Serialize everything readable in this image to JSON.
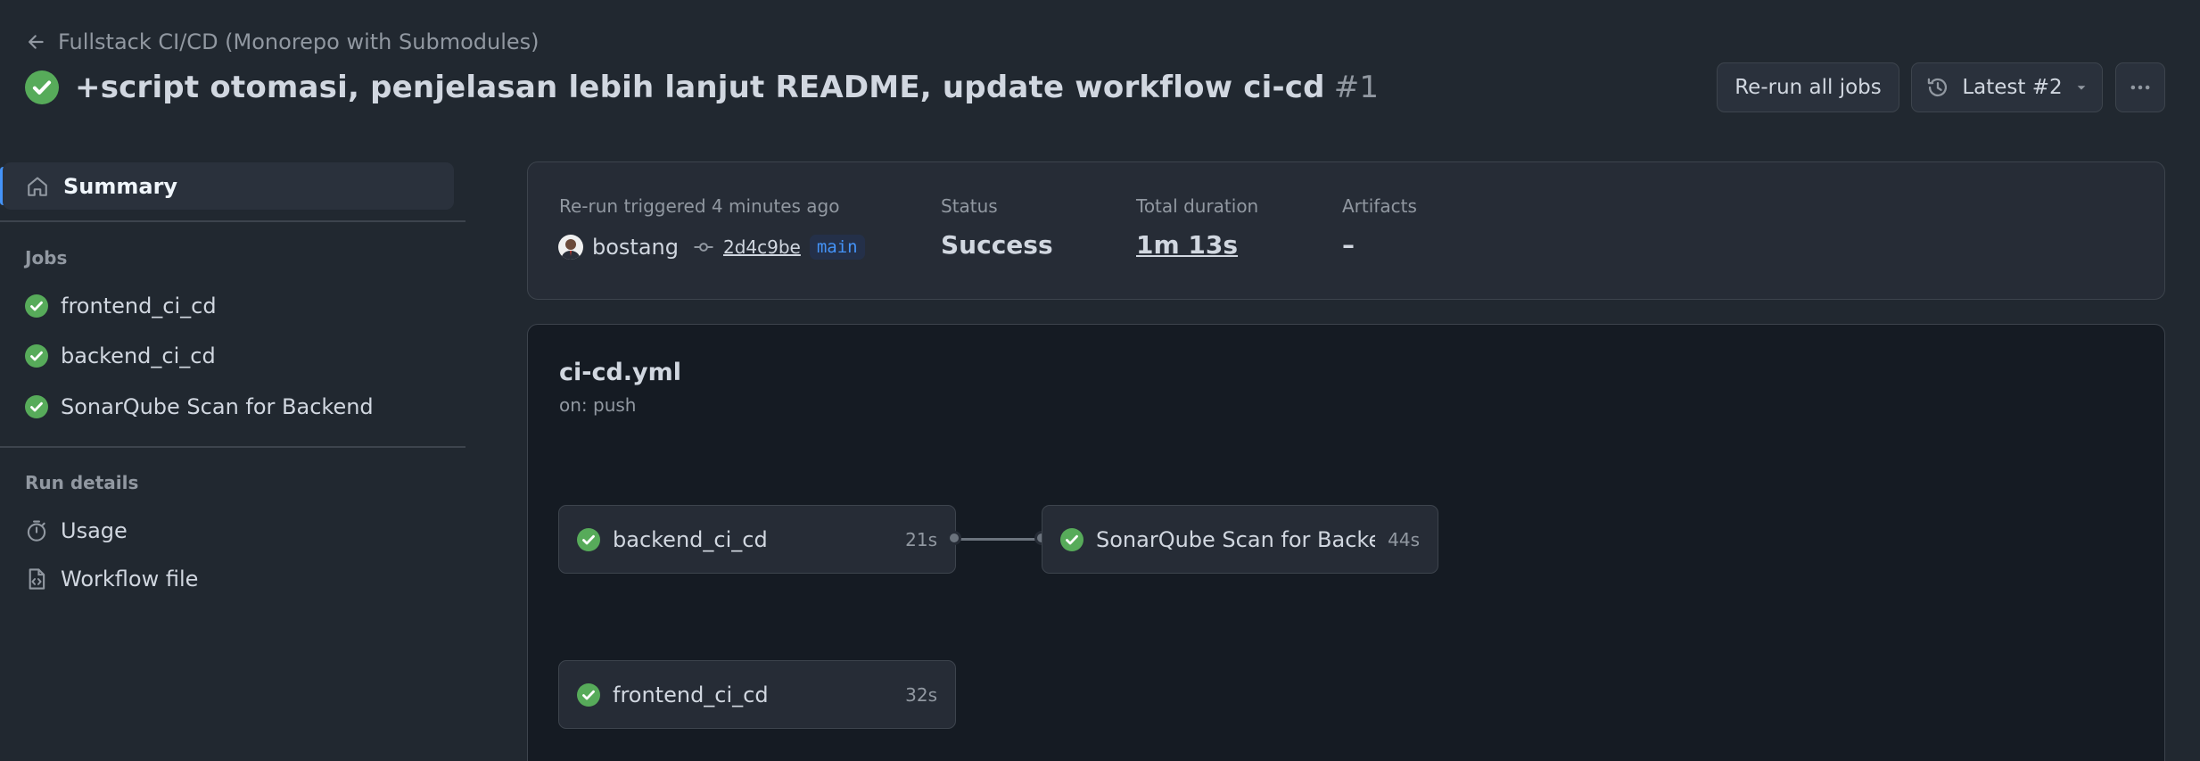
{
  "header": {
    "back_link": "Fullstack CI/CD (Monorepo with Submodules)",
    "title": "+script otomasi, penjelasan lebih lanjut README, update workflow ci-cd",
    "run_number": "#1",
    "rerun_button": "Re-run all jobs",
    "latest_button": "Latest #2"
  },
  "sidebar": {
    "summary_label": "Summary",
    "jobs_heading": "Jobs",
    "jobs": [
      {
        "label": "frontend_ci_cd"
      },
      {
        "label": "backend_ci_cd"
      },
      {
        "label": "SonarQube Scan for Backend"
      }
    ],
    "run_details_heading": "Run details",
    "details": [
      {
        "label": "Usage"
      },
      {
        "label": "Workflow file"
      }
    ]
  },
  "summary": {
    "trigger_label": "Re-run triggered 4 minutes ago",
    "user": "bostang",
    "commit_sha": "2d4c9be",
    "branch": "main",
    "status_label": "Status",
    "status_value": "Success",
    "duration_label": "Total duration",
    "duration_value": "1m 13s",
    "artifacts_label": "Artifacts",
    "artifacts_value": "–"
  },
  "workflow": {
    "file_name": "ci-cd.yml",
    "trigger": "on: push",
    "jobs": [
      {
        "name": "backend_ci_cd",
        "duration": "21s"
      },
      {
        "name": "SonarQube Scan for Backe...",
        "duration": "44s"
      },
      {
        "name": "frontend_ci_cd",
        "duration": "32s"
      }
    ]
  },
  "colors": {
    "background": "#212830",
    "success_green": "#57ab5a",
    "accent_blue": "#4493f8"
  },
  "icons": {
    "back": "arrow-left-icon",
    "success": "check-circle-fill-icon",
    "history": "history-icon",
    "more": "kebab-horizontal-icon",
    "home": "home-icon",
    "stopwatch": "stopwatch-icon",
    "file_code": "file-code-icon",
    "commit": "git-commit-icon"
  }
}
